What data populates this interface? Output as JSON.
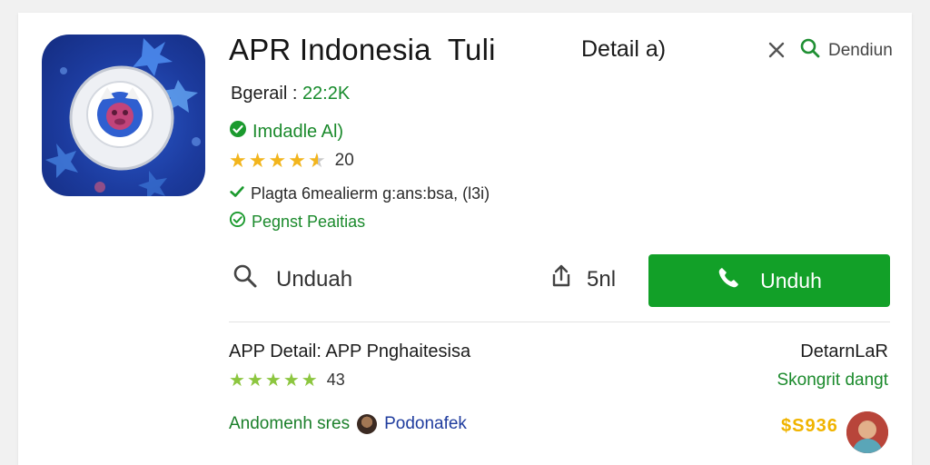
{
  "app": {
    "title": "APR Indonesia  Tuli",
    "detail_link": "Detail a)",
    "search_label": "Dendiun",
    "downloads_label": "Bgerail :",
    "downloads_value": "22:2K",
    "installed_text": "Imdadle  Al)",
    "rating_text": "20",
    "rating_value": 4.5,
    "privacy_text": "Plagta 6mealierm g:ans:bsa, (l3i)",
    "verify_text": "Pegnst Peaitias"
  },
  "actions": {
    "search_label": "Unduah",
    "share_label": "5nl",
    "install_label": "Unduh"
  },
  "similar": {
    "title": "APP Detail: APP Pnghaitesisa",
    "right_label": "DetarnLaR",
    "sub_label": "Skongrit dangt",
    "rating_text": "43",
    "rating_value": 4.5,
    "dev_a": "Andomenh sres",
    "dev_b": "Podonafek",
    "price": "$S936"
  },
  "colors": {
    "accent_green": "#12a028",
    "text_green": "#1b8a2c",
    "star_gold": "#f2b51d",
    "star_lime": "#8cc63f",
    "price_gold": "#f0b400",
    "icon_blue": "#1c3b9e"
  },
  "icons": [
    "app-logo-icon",
    "close-icon",
    "search-icon",
    "check-circle-icon",
    "star-icon",
    "checkmark-icon",
    "share-icon",
    "phone-icon"
  ]
}
